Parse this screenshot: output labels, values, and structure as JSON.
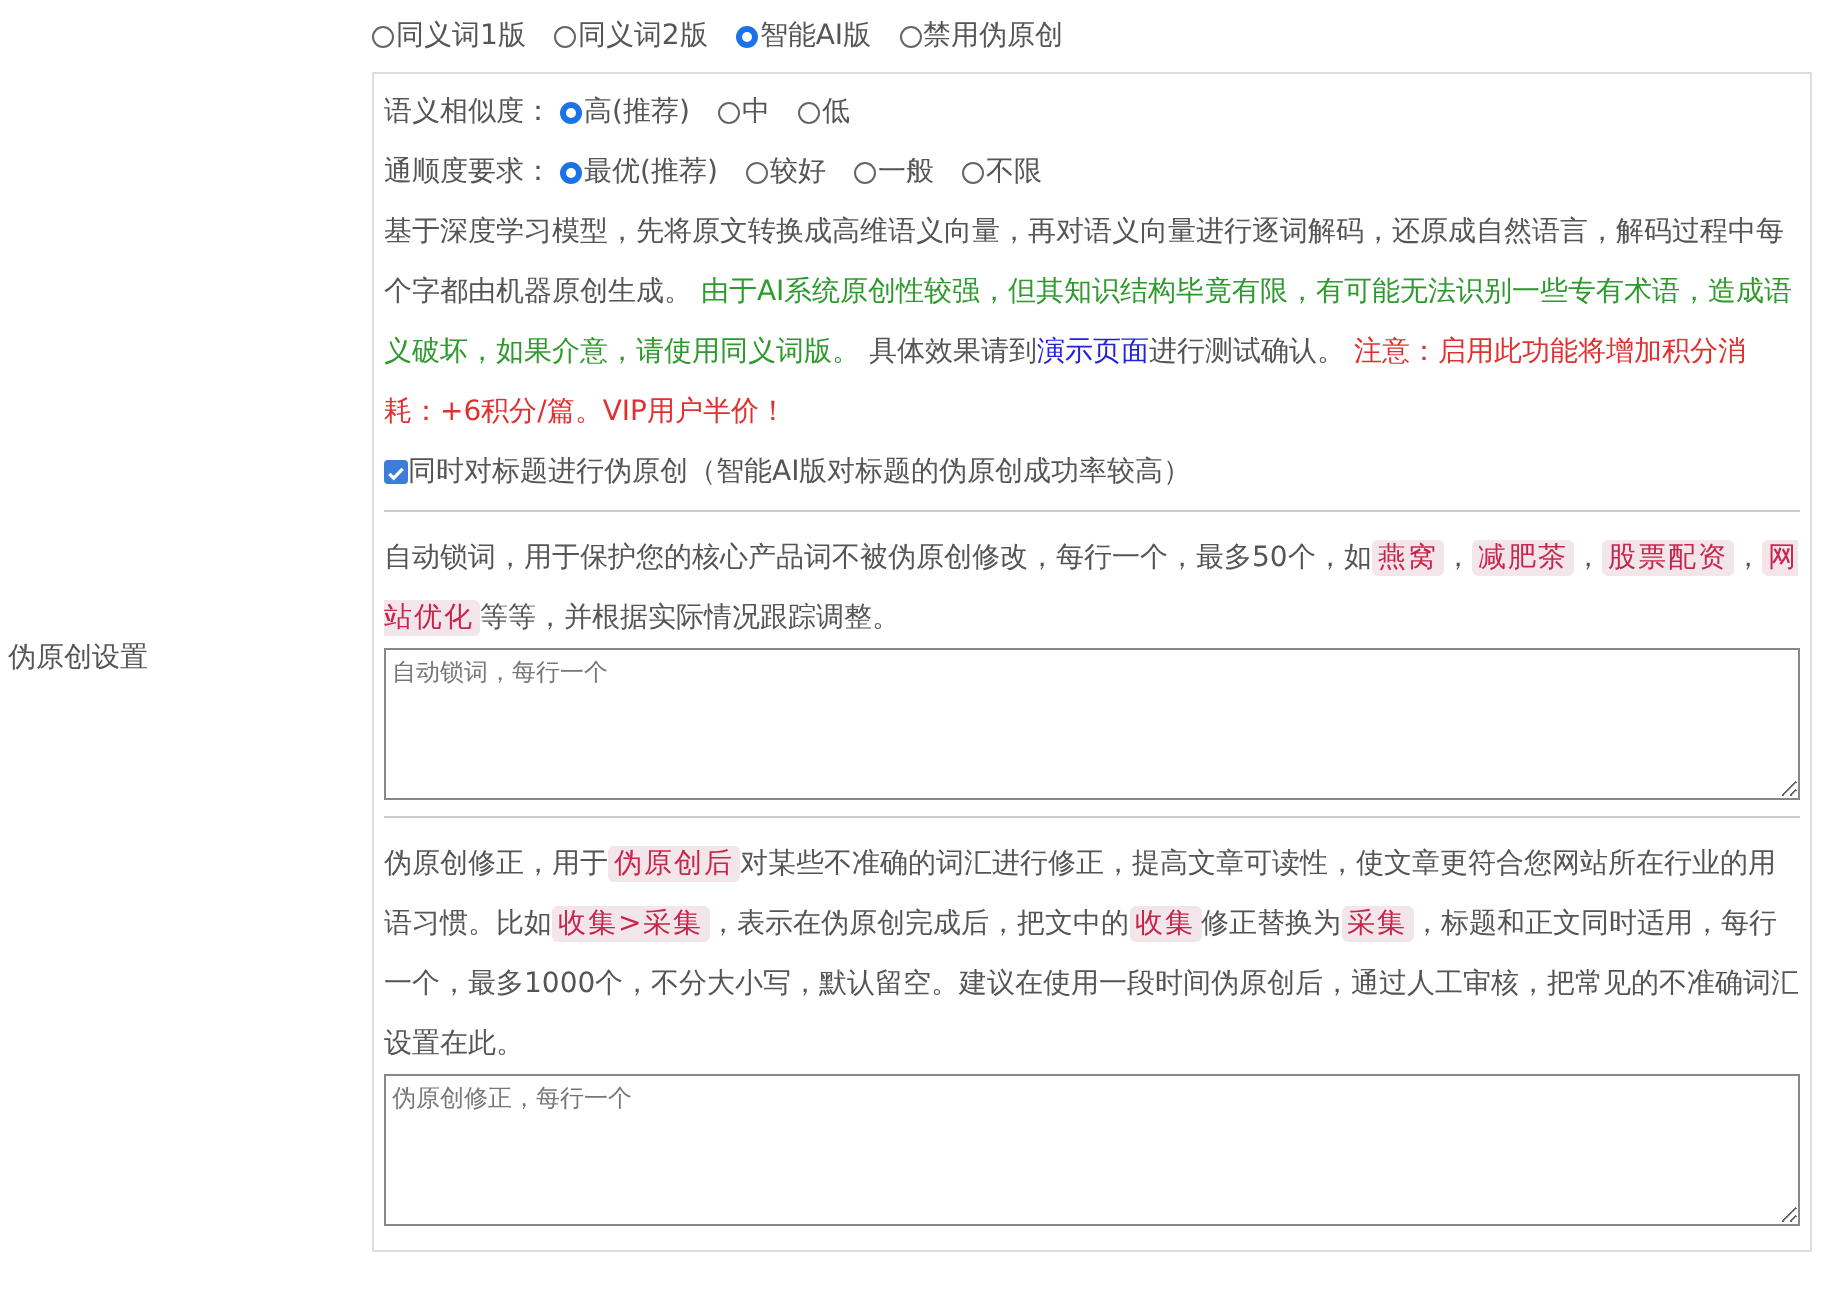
{
  "section_label": "伪原创设置",
  "modes": [
    {
      "label": "同义词1版",
      "selected": false
    },
    {
      "label": "同义词2版",
      "selected": false
    },
    {
      "label": "智能AI版",
      "selected": true
    },
    {
      "label": "禁用伪原创",
      "selected": false
    }
  ],
  "similarity": {
    "label": "语义相似度：",
    "options": [
      {
        "label": "高(推荐)",
        "selected": true
      },
      {
        "label": "中",
        "selected": false
      },
      {
        "label": "低",
        "selected": false
      }
    ]
  },
  "fluency": {
    "label": "通顺度要求：",
    "options": [
      {
        "label": "最优(推荐)",
        "selected": true
      },
      {
        "label": "较好",
        "selected": false
      },
      {
        "label": "一般",
        "selected": false
      },
      {
        "label": "不限",
        "selected": false
      }
    ]
  },
  "description": [
    {
      "kind": "plain",
      "text": "基于深度学习模型，先将原文转换成高维语义向量，再对语义向量进行逐词解码，还原成自然语言，解码过程中每个字都由机器原创生成。 "
    },
    {
      "kind": "note",
      "text": "由于AI系统原创性较强，但其知识结构毕竟有限，有可能无法识别一些专有术语，造成语义破坏，如果介意，请使用同义词版。"
    },
    {
      "kind": "plain",
      "text": " 具体效果请到"
    },
    {
      "kind": "link",
      "text": "演示页面"
    },
    {
      "kind": "plain",
      "text": "进行测试确认。 "
    },
    {
      "kind": "warning",
      "text": "注意：启用此功能将增加积分消耗：+6积分/篇。VIP用户半价！"
    }
  ],
  "title_option": {
    "label": "同时对标题进行伪原创（智能AI版对标题的伪原创成功率较高）",
    "checked": true
  },
  "lock_words": {
    "help": [
      {
        "kind": "plain",
        "text": "自动锁词，用于保护您的核心产品词不被伪原创修改，每行一个，最多50个，如"
      },
      {
        "kind": "code",
        "text": "燕窝"
      },
      {
        "kind": "plain",
        "text": "，"
      },
      {
        "kind": "code",
        "text": "减肥茶"
      },
      {
        "kind": "plain",
        "text": "，"
      },
      {
        "kind": "code",
        "text": "股票配资"
      },
      {
        "kind": "plain",
        "text": "，"
      },
      {
        "kind": "code",
        "text": "网站优化"
      },
      {
        "kind": "plain",
        "text": "等等，并根据实际情况跟踪调整。"
      }
    ],
    "placeholder": "自动锁词，每行一个"
  },
  "corrections": {
    "help": [
      {
        "kind": "plain",
        "text": "伪原创修正，用于"
      },
      {
        "kind": "code",
        "text": "伪原创后"
      },
      {
        "kind": "plain",
        "text": "对某些不准确的词汇进行修正，提高文章可读性，使文章更符合您网站所在行业的用语习惯。比如"
      },
      {
        "kind": "code",
        "text": "收集>采集"
      },
      {
        "kind": "plain",
        "text": "，表示在伪原创完成后，把文中的"
      },
      {
        "kind": "code",
        "text": "收集"
      },
      {
        "kind": "plain",
        "text": "修正替换为"
      },
      {
        "kind": "code",
        "text": "采集"
      },
      {
        "kind": "plain",
        "text": "，标题和正文同时适用，每行一个，最多1000个，不分大小写，默认留空。建议在使用一段时间伪原创后，通过人工审核，把常见的不准确词汇设置在此。"
      }
    ],
    "placeholder": "伪原创修正，每行一个"
  }
}
